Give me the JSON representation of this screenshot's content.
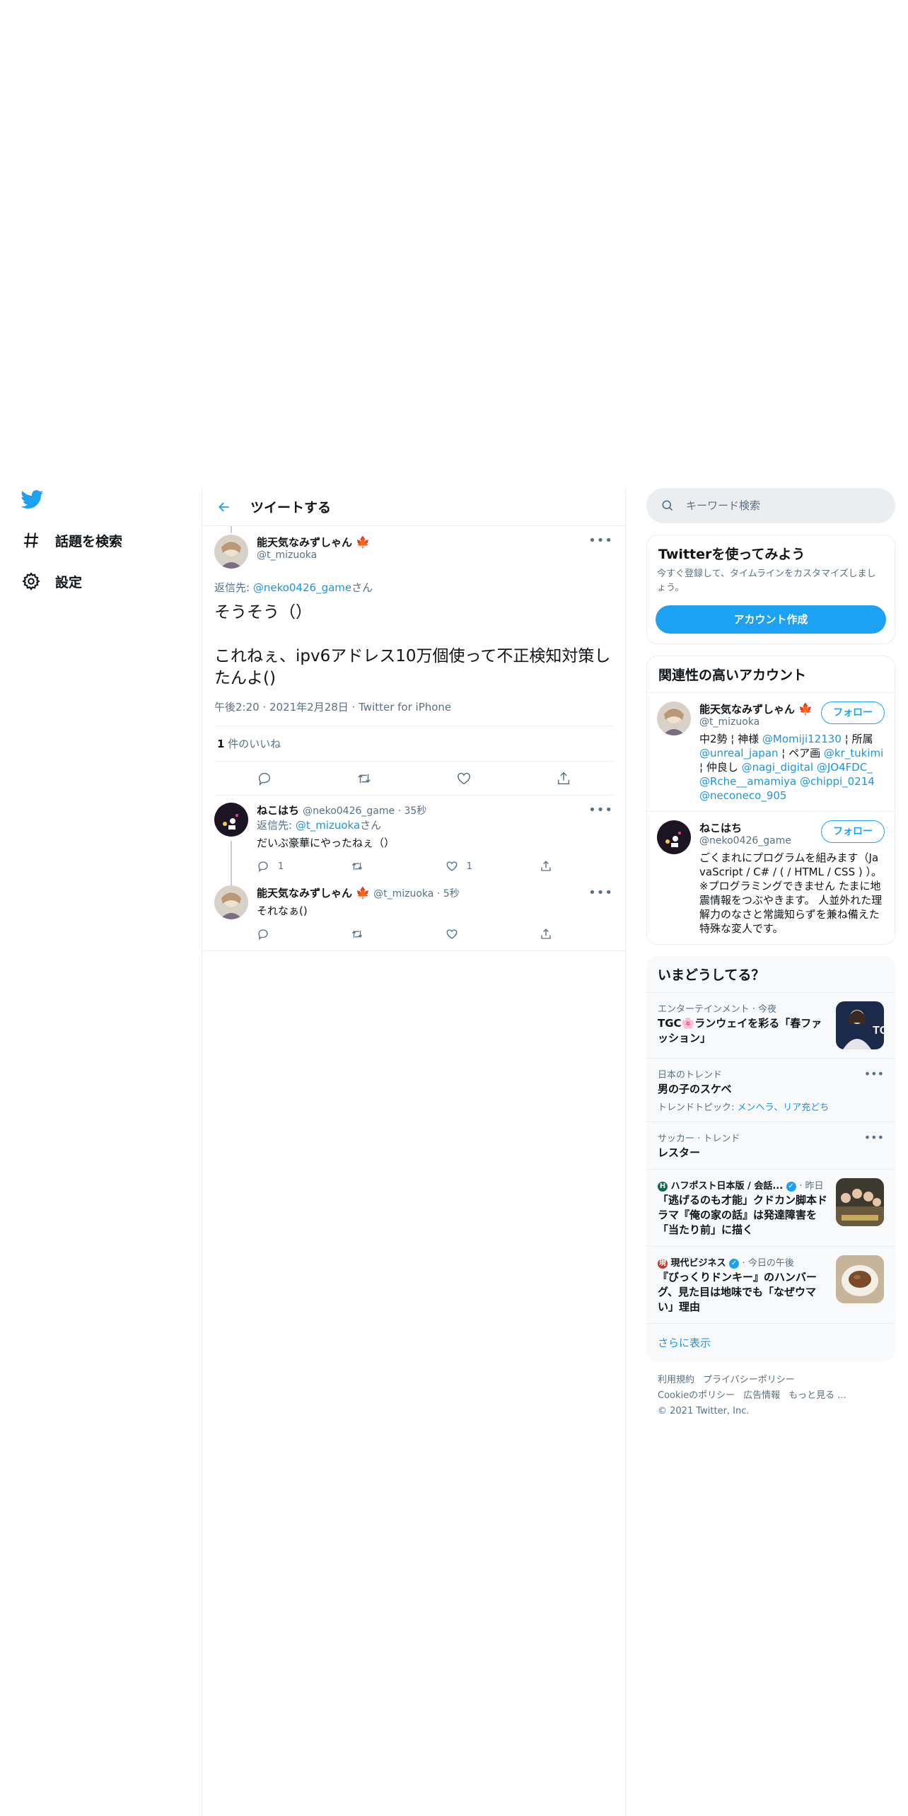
{
  "nav": {
    "explore_label": "話題を検索",
    "settings_label": "設定"
  },
  "header": {
    "title": "ツイートする"
  },
  "focus_tweet": {
    "author_name": "能天気なみずしゃん",
    "author_handle": "@t_mizuoka",
    "reply_prefix": "返信先: ",
    "reply_to": "@neko0426_game",
    "reply_suffix": "さん",
    "text": "そうそう（）\n\nこれねぇ、ipv6アドレス10万個使って不正検知対策したんよ()",
    "timestamp": "午後2:20 · 2021年2月28日 · Twitter for iPhone",
    "like_count": "1",
    "like_label": " 件のいいね"
  },
  "replies": [
    {
      "author_name": "ねこはち",
      "author_handle": "@neko0426_game",
      "time": "35秒",
      "reply_prefix": "返信先: ",
      "reply_to": "@t_mizuoka",
      "reply_suffix": "さん",
      "text": "だいぶ豪華にやったねぇ（）",
      "reply_count": "1",
      "like_count": "1"
    },
    {
      "author_name": "能天気なみずしゃん",
      "author_handle": "@t_mizuoka",
      "time": "5秒",
      "text": "それなぁ()"
    }
  ],
  "search": {
    "placeholder": "キーワード検索"
  },
  "signup": {
    "title": "Twitterを使ってみよう",
    "desc": "今すぐ登録して、タイムラインをカスタマイズしましょう。",
    "button": "アカウント作成"
  },
  "related": {
    "title": "関連性の高いアカウント",
    "follow_label": "フォロー",
    "accounts": [
      {
        "name": "能天気なみずしゃん",
        "handle": "@t_mizuoka",
        "bio_1": "中2勢 ¦ 神様 ",
        "bio_2": "@Momiji12130",
        "bio_3": " ¦ 所属 ",
        "bio_4": "@unreal_japan",
        "bio_5": " ¦ ペア画 ",
        "bio_6": "@kr_tukimi",
        "bio_7": " ¦ 仲良し ",
        "bio_8": "@nagi_digital @JO4FDC_ @Rche__amamiya @chippi_0214 @neconeco_905"
      },
      {
        "name": "ねこはち",
        "handle": "@neko0426_game",
        "bio": "ごくまれにプログラムを組みます（JavaScript / C# / ( / HTML / CSS ) ）。※プログラミングできません たまに地震情報をつぶやきます。 人並外れた理解力のなさと常識知らずを兼ね備えた特殊な変人です。"
      }
    ]
  },
  "trends": {
    "title": "いまどうしてる？",
    "items": [
      {
        "category": "エンターテインメント · 今夜",
        "title": "TGC🌸ランウェイを彩る「春ファッション」"
      },
      {
        "category": "日本のトレンド",
        "title": "男の子のスケベ",
        "sub_label": "トレンドトピック: ",
        "sub_links": "メンヘラ、リア充どち"
      },
      {
        "category": "サッカー · トレンド",
        "title": "レスター"
      },
      {
        "category": "ハフポスト日本版 / 会話...",
        "time": "· 昨日",
        "title": "「逃げるのも才能」クドカン脚本ドラマ『俺の家の話』は発達障害を「当たり前」に描く"
      },
      {
        "category": "現代ビジネス",
        "time": "· 今日の午後",
        "title": "『びっくりドンキー』のハンバーグ、見た目は地味でも「なぜウマい」理由"
      }
    ],
    "show_more": "さらに表示"
  },
  "footer": {
    "terms": "利用規約",
    "privacy": "プライバシーポリシー",
    "cookie": "Cookieのポリシー",
    "ads": "広告情報",
    "more": "もっと見る ...",
    "copyright": "© 2021 Twitter, Inc."
  },
  "colors": {
    "accent": "#1da1f2",
    "link": "#1b95e0",
    "muted": "#5b7083",
    "border": "#ebeef0",
    "maple": "#d9232c"
  }
}
